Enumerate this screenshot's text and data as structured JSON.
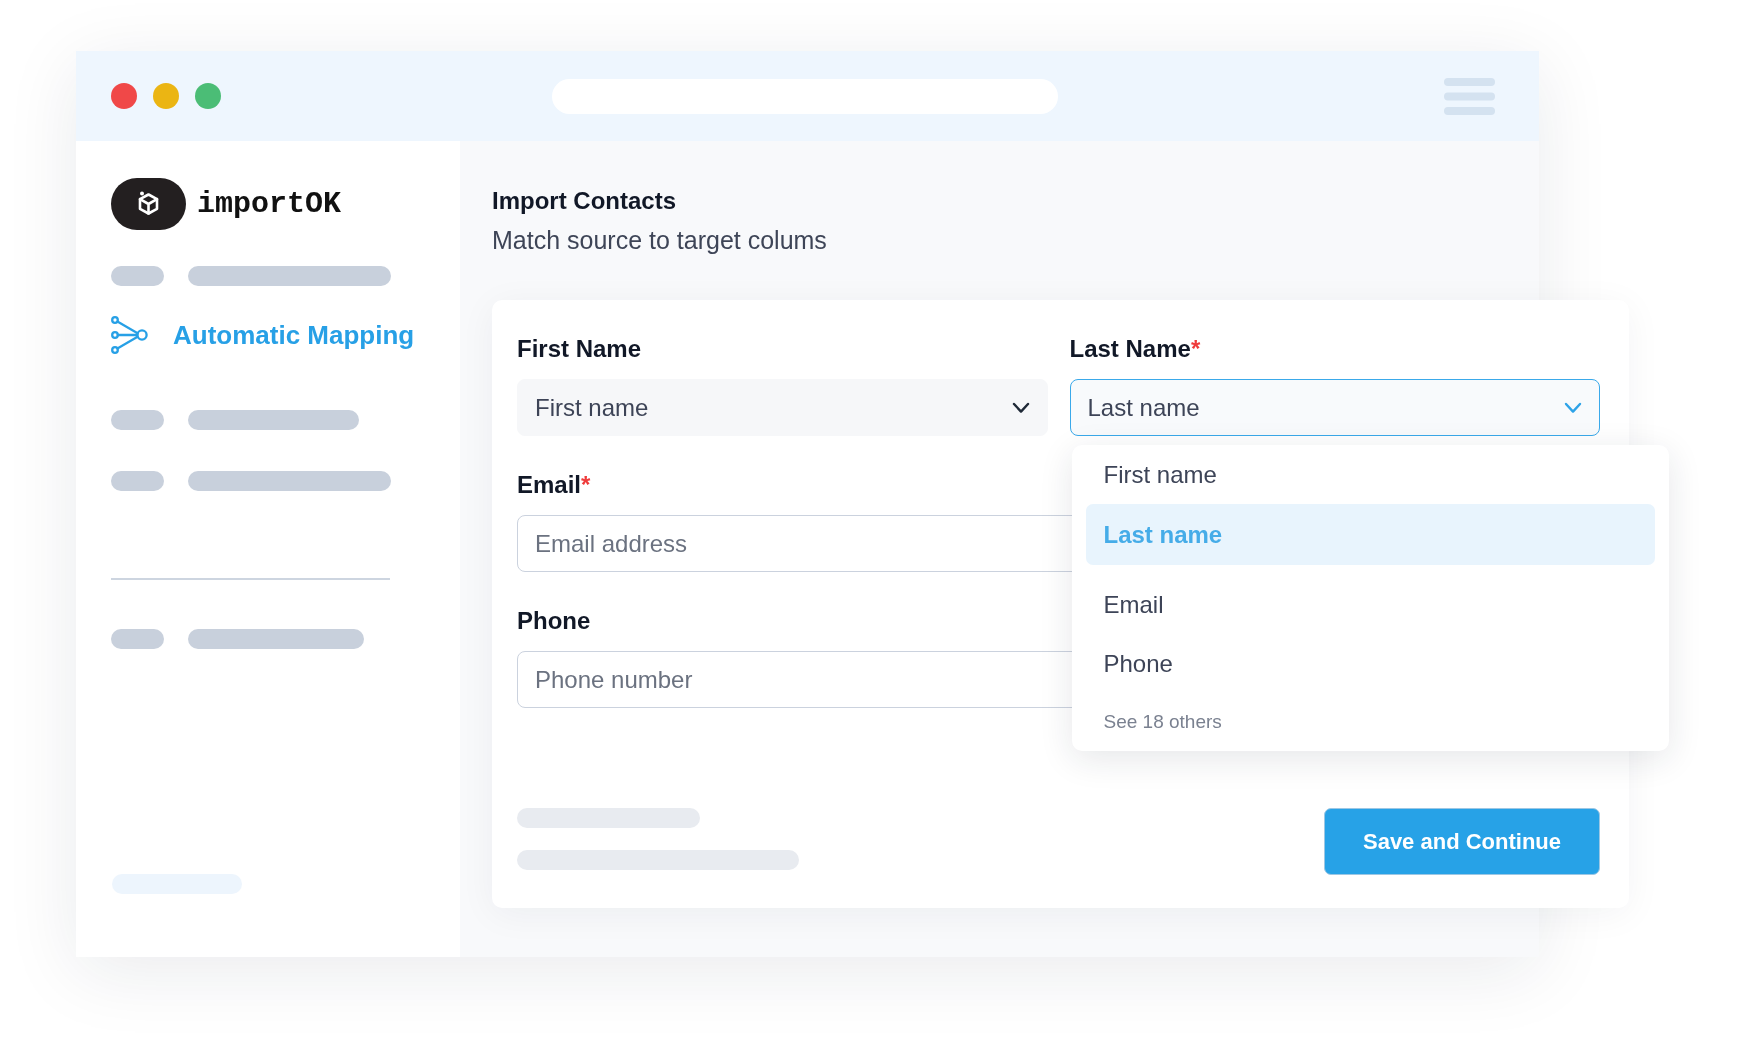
{
  "sidebar": {
    "logo_text": "importOK",
    "items": [
      {
        "label": "Automatic Mapping",
        "selected": true
      }
    ]
  },
  "main": {
    "title": "Import Contacts",
    "subtitle": "Match source to target colums"
  },
  "form": {
    "fields": [
      {
        "kind": "select",
        "label": "First Name",
        "value": "First name",
        "expanded": false
      },
      {
        "kind": "select",
        "label": "Last Name",
        "required_mark": "*",
        "value": "Last name",
        "expanded": true,
        "options": [
          {
            "label": "First name",
            "selected": false
          },
          {
            "label": "Last name",
            "selected": true
          },
          {
            "label": "Email",
            "selected": false
          },
          {
            "label": "Phone",
            "selected": false
          }
        ],
        "more_link": "See 18 others"
      },
      {
        "kind": "input",
        "label": "Email",
        "required_mark": "*",
        "placeholder": "Email address"
      },
      {
        "kind": "input",
        "label": "Phone",
        "placeholder": "Phone number"
      }
    ],
    "submit_button": "Save and Continue"
  }
}
